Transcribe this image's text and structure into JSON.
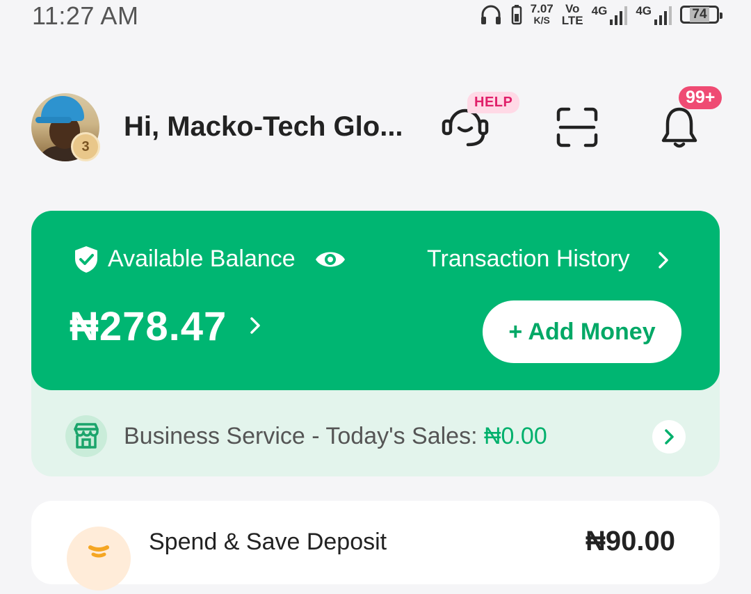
{
  "status_bar": {
    "time": "11:27 AM",
    "net_speed": "7.07",
    "net_speed_unit": "K/S",
    "volte_top": "Vo",
    "volte_bottom": "LTE",
    "sim1": "4G",
    "sim2": "4G",
    "battery": "74"
  },
  "header": {
    "greeting": "Hi, Macko-Tech Glo...",
    "level": "3",
    "help_label": "HELP",
    "notifications_count": "99+"
  },
  "balance_card": {
    "label": "Available Balance",
    "transaction_history": "Transaction History",
    "amount": "₦278.47",
    "add_money": "+ Add Money"
  },
  "business": {
    "label": "Business Service - Today's Sales: ",
    "sales": "₦0.00"
  },
  "spend_save": {
    "title": "Spend & Save Deposit",
    "amount": "₦90.00"
  },
  "colors": {
    "brand_green": "#00b672",
    "light_green": "#e3f4ec",
    "notification_red": "#ef4b73",
    "help_pink": "#e0206a"
  },
  "icons": [
    "headphones-icon",
    "battery-saver-icon",
    "signal-icon",
    "battery-icon",
    "headset-icon",
    "scan-icon",
    "bell-icon",
    "shield-check-icon",
    "eye-icon",
    "chevron-right-icon",
    "store-icon",
    "piggy-icon"
  ]
}
